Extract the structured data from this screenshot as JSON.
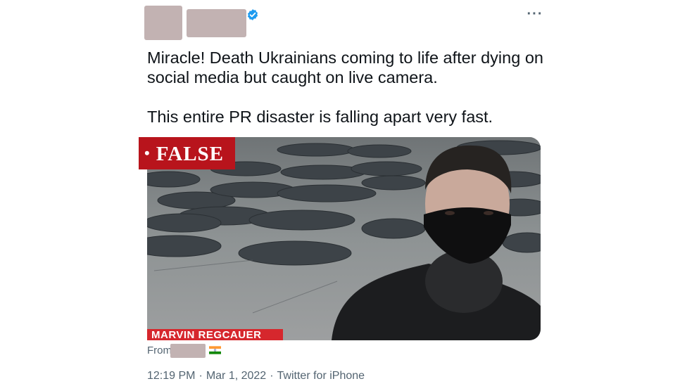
{
  "tweet": {
    "text": "Miracle! Death Ukrainians coming to life after dying on social media but caught on live camera.\n\nThis entire PR disaster is falling apart very fast.",
    "more_icon": "more-horizontal-icon",
    "verified_icon": "verified-badge-icon"
  },
  "media": {
    "badge": "FALSE",
    "caption": "MARVIN REGCAUER"
  },
  "location": {
    "from_label": "From",
    "flag_icon": "india-flag-icon"
  },
  "meta": {
    "time": "12:19 PM",
    "date": "Mar 1, 2022",
    "source": "Twitter for iPhone",
    "separator": "·"
  },
  "colors": {
    "verified": "#1d9bf0",
    "text": "#0f1419",
    "secondary": "#536471",
    "false_badge": "#b8141c",
    "redaction": "#c2b2b2"
  }
}
